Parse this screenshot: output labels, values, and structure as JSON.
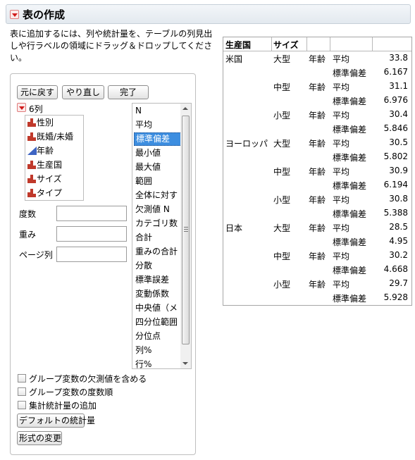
{
  "header": {
    "title": "表の作成"
  },
  "instructions": {
    "line1": "表に追加するには、列や統計量を、テーブルの列見出",
    "line2": "しや行ラベルの領域にドラッグ＆ドロップしてくださ",
    "line3": "い。"
  },
  "buttons": {
    "undo": "元に戻す",
    "redo": "やり直し",
    "done": "完了",
    "default_stats": "デフォルトの統計量",
    "change_format": "形式の変更"
  },
  "columns_panel": {
    "count_label": "6列",
    "items": [
      {
        "label": "性別",
        "icon": "nominal-icon"
      },
      {
        "label": "既婚/未婚",
        "icon": "nominal-icon"
      },
      {
        "label": "年齢",
        "icon": "continuous-icon"
      },
      {
        "label": "生産国",
        "icon": "nominal-icon"
      },
      {
        "label": "サイズ",
        "icon": "nominal-icon"
      },
      {
        "label": "タイプ",
        "icon": "nominal-icon"
      }
    ]
  },
  "role_fields": {
    "freq_label": "度数",
    "weight_label": "重み",
    "page_label": "ページ列"
  },
  "stats_list": {
    "items": [
      "N",
      "平均",
      "標準偏差",
      "最小値",
      "最大値",
      "範囲",
      "全体に対す",
      "欠測値 N",
      "カテゴリ数",
      "合計",
      "重みの合計",
      "分散",
      "標準誤差",
      "変動係数",
      "中央値（メ",
      "四分位範囲",
      "分位点",
      "列%",
      "行%"
    ],
    "selected": "標準偏差"
  },
  "options": {
    "include_missing": "グループ変数の欠測値を含める",
    "order_by_count": "グループ変数の度数順",
    "add_aggregate": "集計統計量の追加"
  },
  "result_table": {
    "headers": [
      "生産国",
      "サイズ"
    ],
    "rows": [
      [
        "米国",
        "大型",
        "年齢",
        "平均",
        "33.8"
      ],
      [
        "",
        "",
        "",
        "標準偏差",
        "6.167"
      ],
      [
        "",
        "中型",
        "年齢",
        "平均",
        "31.1"
      ],
      [
        "",
        "",
        "",
        "標準偏差",
        "6.976"
      ],
      [
        "",
        "小型",
        "年齢",
        "平均",
        "30.4"
      ],
      [
        "",
        "",
        "",
        "標準偏差",
        "5.846"
      ],
      [
        "ヨーロッパ",
        "大型",
        "年齢",
        "平均",
        "30.5"
      ],
      [
        "",
        "",
        "",
        "標準偏差",
        "5.802"
      ],
      [
        "",
        "中型",
        "年齢",
        "平均",
        "30.9"
      ],
      [
        "",
        "",
        "",
        "標準偏差",
        "6.194"
      ],
      [
        "",
        "小型",
        "年齢",
        "平均",
        "30.8"
      ],
      [
        "",
        "",
        "",
        "標準偏差",
        "5.388"
      ],
      [
        "日本",
        "大型",
        "年齢",
        "平均",
        "28.5"
      ],
      [
        "",
        "",
        "",
        "標準偏差",
        "4.95"
      ],
      [
        "",
        "中型",
        "年齢",
        "平均",
        "30.2"
      ],
      [
        "",
        "",
        "",
        "標準偏差",
        "4.668"
      ],
      [
        "",
        "小型",
        "年齢",
        "平均",
        "29.7"
      ],
      [
        "",
        "",
        "",
        "標準偏差",
        "5.928"
      ]
    ]
  },
  "colors": {
    "accent_red": "#d11a1a",
    "selection_blue": "#3d8ee0",
    "continuous_blue": "#3e64c3"
  }
}
